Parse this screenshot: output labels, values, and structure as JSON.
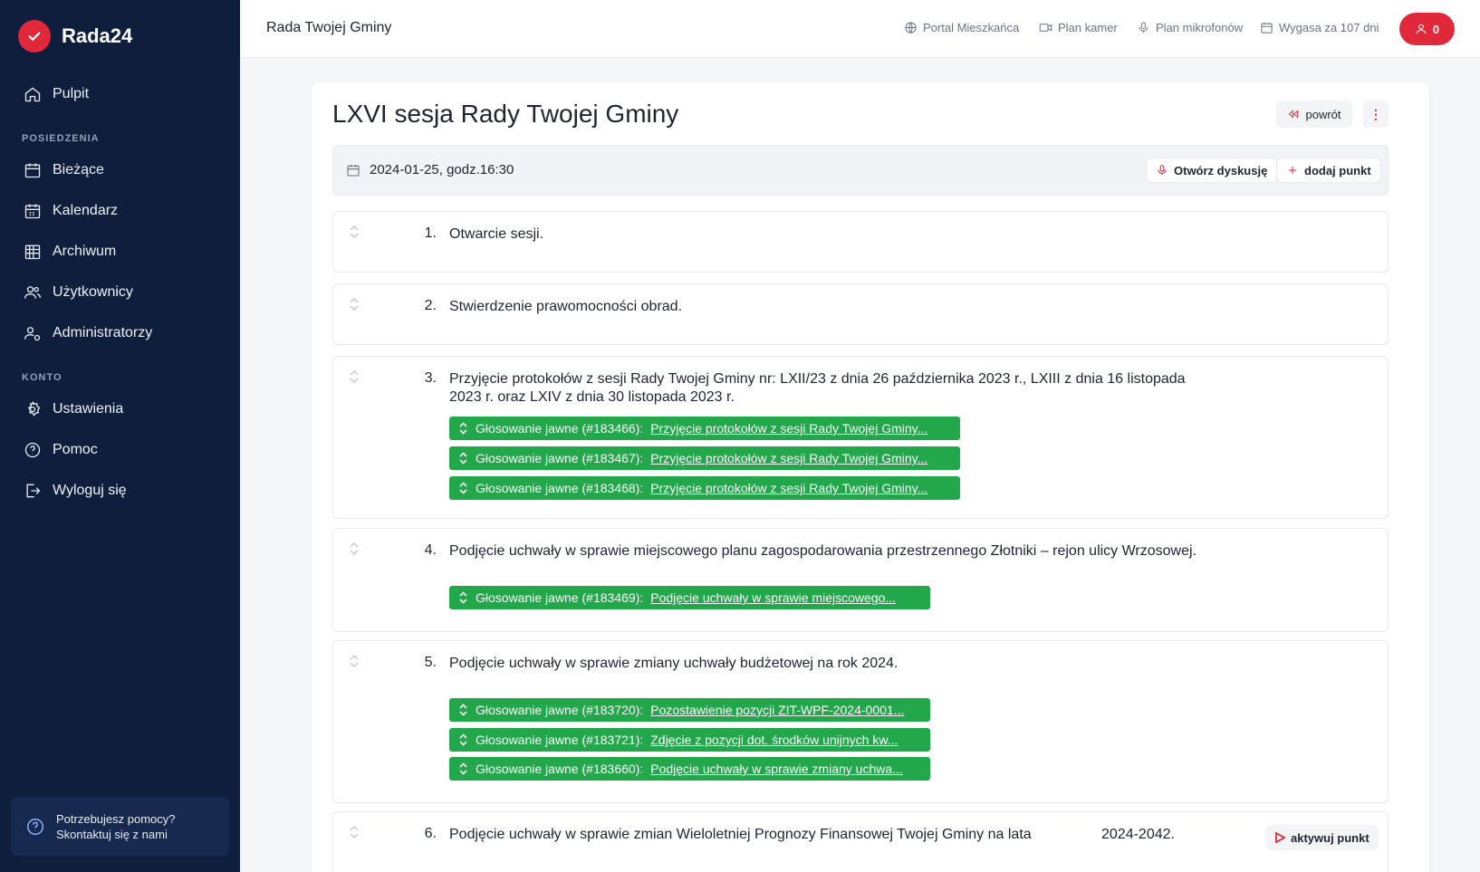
{
  "app": {
    "name": "Rada24"
  },
  "sidebar": {
    "top_item": {
      "label": "Pulpit",
      "icon": "home-icon"
    },
    "sections": [
      {
        "title": "POSIEDZENIA",
        "items": [
          {
            "label": "Bieżące",
            "icon": "calendar-icon"
          },
          {
            "label": "Kalendarz",
            "icon": "calendar-grid-icon"
          },
          {
            "label": "Archiwum",
            "icon": "archive-icon"
          },
          {
            "label": "Użytkownicy",
            "icon": "users-icon"
          },
          {
            "label": "Administratorzy",
            "icon": "admin-icon"
          }
        ]
      },
      {
        "title": "KONTO",
        "items": [
          {
            "label": "Ustawienia",
            "icon": "gear-icon"
          },
          {
            "label": "Pomoc",
            "icon": "help-icon"
          },
          {
            "label": "Wyloguj się",
            "icon": "logout-icon"
          }
        ]
      }
    ],
    "help": {
      "line1": "Potrzebujesz pomocy?",
      "line2": "Skontaktuj się z nami"
    }
  },
  "topbar": {
    "title": "Rada Twojej Gminy",
    "links": [
      {
        "label": "Portal Mieszkańca",
        "icon": "globe-icon"
      },
      {
        "label": "Plan kamer",
        "icon": "camera-icon"
      },
      {
        "label": "Plan mikrofonów",
        "icon": "microphone-icon"
      },
      {
        "label": "Wygasa za 107 dni",
        "icon": "calendar-icon"
      }
    ],
    "user_count": "0"
  },
  "session": {
    "title": "LXVI sesja Rady Twojej Gminy",
    "back_label": "powrót",
    "more_label": "⋮",
    "date": "2024-01-25, godz.16:30",
    "open_discussion_label": "Otwórz dyskusję",
    "add_point_label": "dodaj punkt",
    "activate_label": "aktywuj punkt",
    "accent_color": "#e0283a",
    "vote_color": "#22a84a"
  },
  "points": [
    {
      "num": "1.",
      "title": "Otwarcie sesji.",
      "votes": []
    },
    {
      "num": "2.",
      "title": "Stwierdzenie prawomocności obrad.",
      "votes": []
    },
    {
      "num": "3.",
      "title_lines": [
        "Przyjęcie protokołów z sesji Rady Twojej Gminy nr: LXII/23 z dnia 26 października 2023 r., LXIII z dnia 16 listopada",
        "2023 r. oraz LXIV z dnia 30 listopada 2023 r."
      ],
      "votes": [
        {
          "prefix": "Głosowanie jawne (#183466):",
          "link": "Przyjęcie protokołów z sesji Rady Twojej Gminy..."
        },
        {
          "prefix": "Głosowanie jawne (#183467):",
          "link": "Przyjęcie protokołów z sesji Rady Twojej Gminy..."
        },
        {
          "prefix": "Głosowanie jawne (#183468):",
          "link": "Przyjęcie protokołów z sesji Rady Twojej Gminy..."
        }
      ]
    },
    {
      "num": "4.",
      "title": "Podjęcie uchwały w sprawie miejscowego planu zagospodarowania przestrzennego Złotniki – rejon ulicy Wrzosowej.",
      "votes": [
        {
          "prefix": "Głosowanie jawne (#183469):",
          "link": "Podjęcie uchwały w sprawie miejscowego..."
        }
      ]
    },
    {
      "num": "5.",
      "title": "Podjęcie uchwały w sprawie zmiany uchwały budżetowej na rok 2024.",
      "votes": [
        {
          "prefix": "Głosowanie jawne (#183720):",
          "link": "Pozostawienie pozycji ZIT-WPF-2024-0001..."
        },
        {
          "prefix": "Głosowanie jawne (#183721):",
          "link": "Zdjęcie z pozycji dot. środków unijnych kw..."
        },
        {
          "prefix": "Głosowanie jawne (#183660):",
          "link": "Podjęcie uchwały w sprawie zmiany uchwa..."
        }
      ]
    },
    {
      "num": "6.",
      "title_a": "Podjęcie uchwały w sprawie zmian Wieloletniej Prognozy Finansowej Twojej Gminy na lata",
      "title_b": "2024-2042.",
      "votes": []
    }
  ]
}
